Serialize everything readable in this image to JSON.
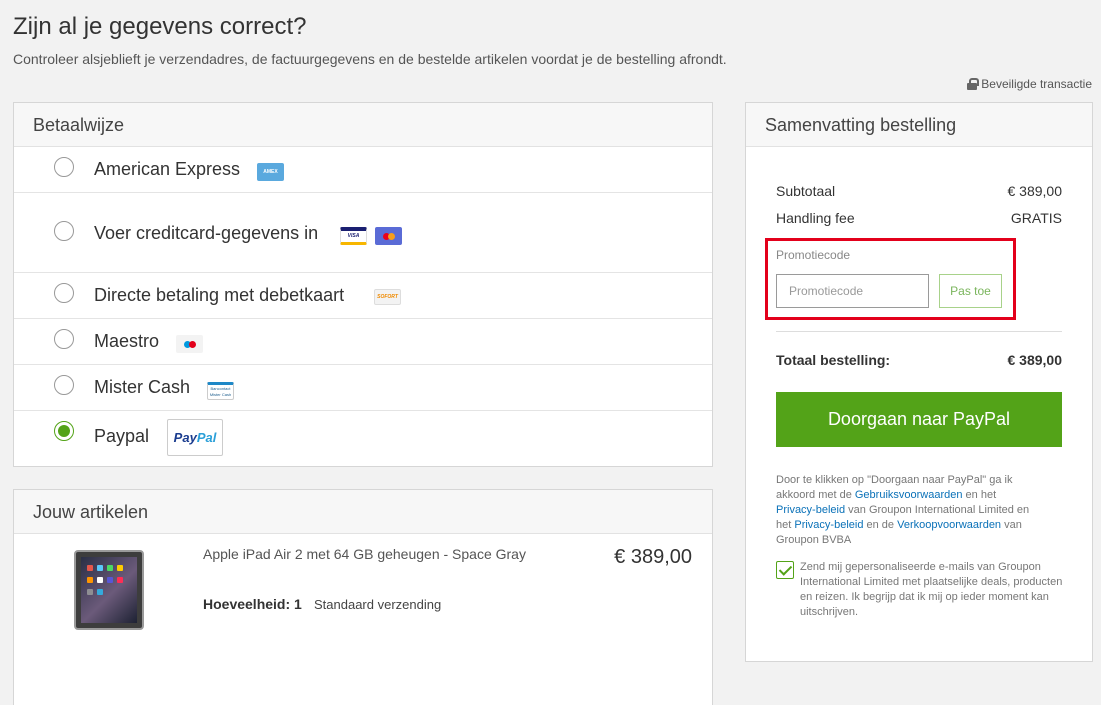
{
  "header": {
    "title": "Zijn al je gegevens correct?",
    "subtitle": "Controleer alsjeblieft je verzendadres, de factuurgegevens en de bestelde artikelen voordat je de bestelling afrondt.",
    "secure_label": "Beveiligde transactie"
  },
  "payment": {
    "title": "Betaalwijze",
    "options": [
      {
        "label": "American Express",
        "selected": false,
        "icon": "amex-icon",
        "icon_text": "AMEX"
      },
      {
        "label": "Voer creditcard-gegevens in",
        "selected": false,
        "icon": "visa-mastercard-icons",
        "icon_text": "VISA"
      },
      {
        "label": "Directe betaling met debetkaart",
        "selected": false,
        "icon": "sofort-icon",
        "icon_text": "SOFORT"
      },
      {
        "label": "Maestro",
        "selected": false,
        "icon": "maestro-icon"
      },
      {
        "label": "Mister Cash",
        "selected": false,
        "icon": "mistercash-icon",
        "icon_text": "Bancontact Mister Cash"
      },
      {
        "label": "Paypal",
        "selected": true,
        "icon": "paypal-icon",
        "icon_text_pay": "Pay",
        "icon_text_pal": "Pal"
      }
    ]
  },
  "articles": {
    "title": "Jouw artikelen",
    "item": {
      "name": "Apple iPad Air 2 met 64 GB geheugen - Space Gray",
      "price": "€ 389,00",
      "quantity_label": "Hoeveelheid: 1",
      "shipping": "Standaard verzending"
    }
  },
  "summary": {
    "title": "Samenvatting bestelling",
    "subtotal_label": "Subtotaal",
    "subtotal_value": "€ 389,00",
    "handling_label": "Handling fee",
    "handling_value": "GRATIS",
    "promo_label": "Promotiecode",
    "promo_placeholder": "Promotiecode",
    "promo_button": "Pas toe",
    "total_label": "Totaal bestelling:",
    "total_value": "€ 389,00",
    "paypal_button": "Doorgaan naar PayPal",
    "legal": {
      "part1": "Door te klikken op \"Doorgaan naar PayPal\" ga ik akkoord met de ",
      "link_terms": "Gebruiksvoorwaarden",
      "part2": " en het ",
      "link_privacy1": "Privacy-beleid",
      "part3": " van Groupon International Limited en het ",
      "link_privacy2": "Privacy-beleid",
      "part4": " en de ",
      "link_sales": "Verkoopvoorwaarden",
      "part5": " van Groupon BVBA"
    },
    "newsletter_checked": true,
    "newsletter_text": "Zend mij gepersonaliseerde e-mails van Groupon International Limited met plaatselijke deals, producten en reizen. Ik begrijp dat ik mij op ieder moment kan uitschrijven."
  },
  "colors": {
    "accent_green": "#53a318",
    "highlight_red": "#e3001b",
    "link_blue": "#0a71b8"
  }
}
